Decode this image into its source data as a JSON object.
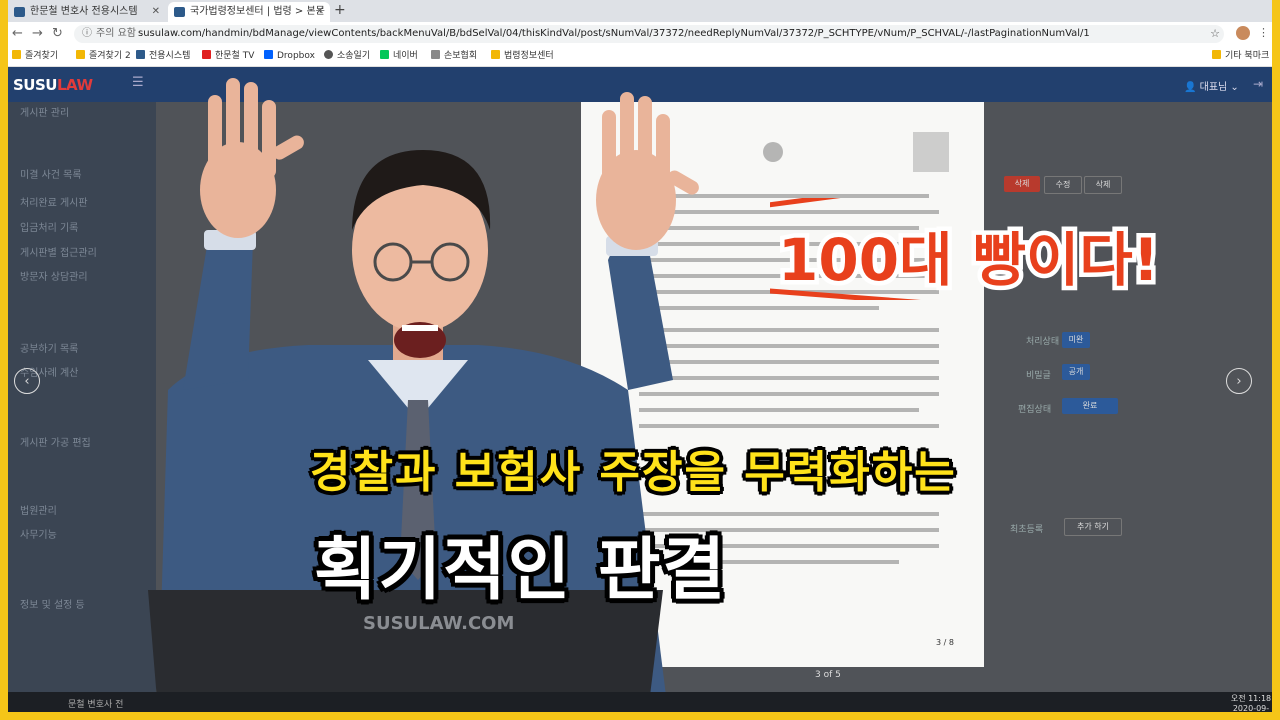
{
  "browser": {
    "tabs": [
      {
        "label": "한문철 변호사 전용시스템",
        "active": false
      },
      {
        "label": "국가법령정보센터 | 법령 > 본문",
        "active": true
      }
    ],
    "address": {
      "security_label": "주의 요함",
      "url": "susulaw.com/handmin/bdManage/viewContents/backMenuVal/B/bdSelVal/04/thisKindVal/post/sNumVal/37372/needReplyNumVal/37372/P_SCHTYPE/vNum/P_SCHVAL/-/lastPaginationNumVal/1"
    },
    "bookmarks": [
      {
        "label": "즐겨찾기",
        "color": "#f2b705"
      },
      {
        "label": "즐겨찾기 2",
        "color": "#f2b705"
      },
      {
        "label": "전용시스템",
        "color": "#2d5a8a"
      },
      {
        "label": "한문철 TV",
        "color": "#e02020"
      },
      {
        "label": "Dropbox",
        "color": "#0061fe"
      },
      {
        "label": "소송일기",
        "color": "#555555"
      },
      {
        "label": "네이버",
        "color": "#03c75a"
      },
      {
        "label": "손보협회",
        "color": "#888888"
      },
      {
        "label": "법령정보센터",
        "color": "#f2b705"
      }
    ],
    "other_bookmarks": "기타 북마크"
  },
  "app": {
    "logo_prefix": "SUSU",
    "logo_suffix": "LAW",
    "user_label": "대표님",
    "sidebar_items": [
      "게시판 관리",
      "미결 사건 목록",
      "처리완료 게시판",
      "입금처리 기록",
      "게시판별 접근관리",
      "방문자 상담관리",
      "",
      "공부하기 목록",
      "수임사례 계산",
      "",
      "게시판 가공 편집",
      "",
      "법원관리",
      "사무기능",
      "",
      "정보 및 설정 등"
    ],
    "document_page": "3 / 8",
    "page_count": "3 of 5",
    "right_panel": {
      "buttons": [
        "삭제",
        "수정",
        "삭제"
      ],
      "labels": [
        "처리상태",
        "비밀글",
        "편집상태",
        "최초등록"
      ],
      "toggle_values": [
        "미완",
        "공개",
        "완료"
      ],
      "add_button": "추가 하기"
    },
    "laptop_logo": "SUSULAW.COM"
  },
  "overlay": {
    "sticker_text": "100대 빵이다!",
    "caption_line1": "경찰과 보험사 주장을 무력화하는",
    "caption_line2": "획기적인 판결"
  },
  "taskbar": {
    "window_label": "문철 변호사 전",
    "time": "오전 11:18",
    "date": "2020-09-15"
  },
  "colors": {
    "frame": "#f5c518",
    "header": "#22406e",
    "logo_accent": "#e23b3b",
    "caption_yellow": "#ffe21a",
    "sticker_red": "#e8401c"
  }
}
